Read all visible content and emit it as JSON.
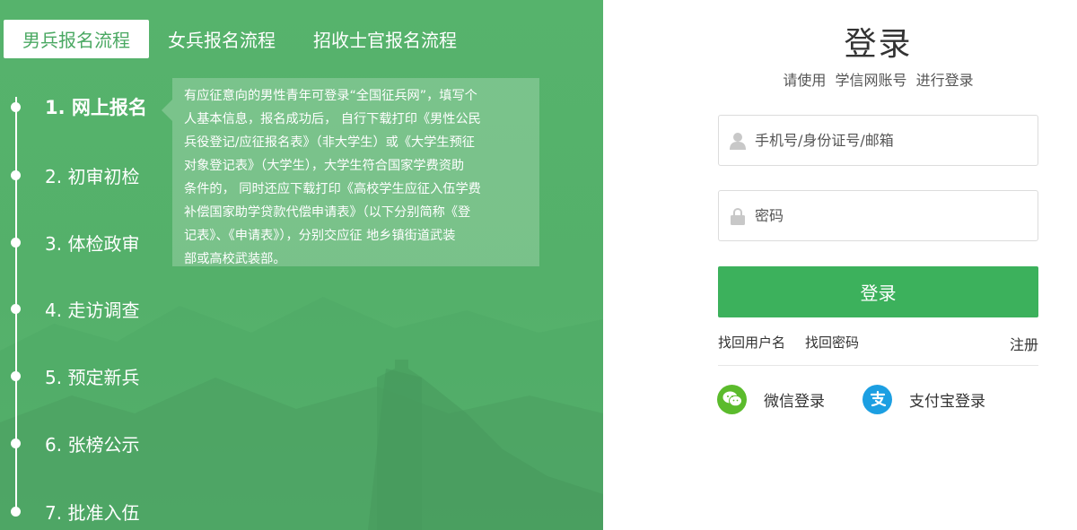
{
  "tabs": [
    {
      "label": "男兵报名流程",
      "active": true
    },
    {
      "label": "女兵报名流程",
      "active": false
    },
    {
      "label": "招收士官报名流程",
      "active": false
    }
  ],
  "steps": [
    {
      "label": "1. 网上报名"
    },
    {
      "label": "2. 初审初检"
    },
    {
      "label": "3. 体检政审"
    },
    {
      "label": "4. 走访调查"
    },
    {
      "label": "5. 预定新兵"
    },
    {
      "label": "6. 张榜公示"
    },
    {
      "label": "7. 批准入伍"
    }
  ],
  "tooltip": {
    "lines": [
      "有应征意向的男性青年可登录“全国征兵网”，填写个",
      "人基本信息，报名成功后， 自行下载打印《男性公民",
      "兵役登记/应征报名表》（非大学生）或《大学生预征",
      "对象登记表》（大学生），大学生符合国家学费资助",
      "条件的， 同时还应下载打印《高校学生应征入伍学费",
      "补偿国家助学贷款代偿申请表》（以下分别简称《登",
      "记表》、《申请表》），分别交应征 地乡镇街道武装",
      "部或高校武装部。"
    ]
  },
  "login": {
    "title": "登录",
    "subtitle": "请使用  学信网账号  进行登录",
    "username_placeholder": "手机号/身份证号/邮箱",
    "password_placeholder": "密码",
    "submit_label": "登录",
    "find_username": "找回用户名",
    "find_password": "找回密码",
    "register": "注册",
    "wechat_label": "微信登录",
    "alipay_label": "支付宝登录"
  },
  "icons": {
    "username": "user-icon",
    "password": "lock-icon",
    "wechat": "wechat-icon",
    "alipay": "alipay-icon"
  },
  "colors": {
    "panel_green": "#55b26b",
    "button_green": "#3cb15c",
    "wechat_green": "#5bbb2c",
    "alipay_blue": "#1c9fe2"
  }
}
